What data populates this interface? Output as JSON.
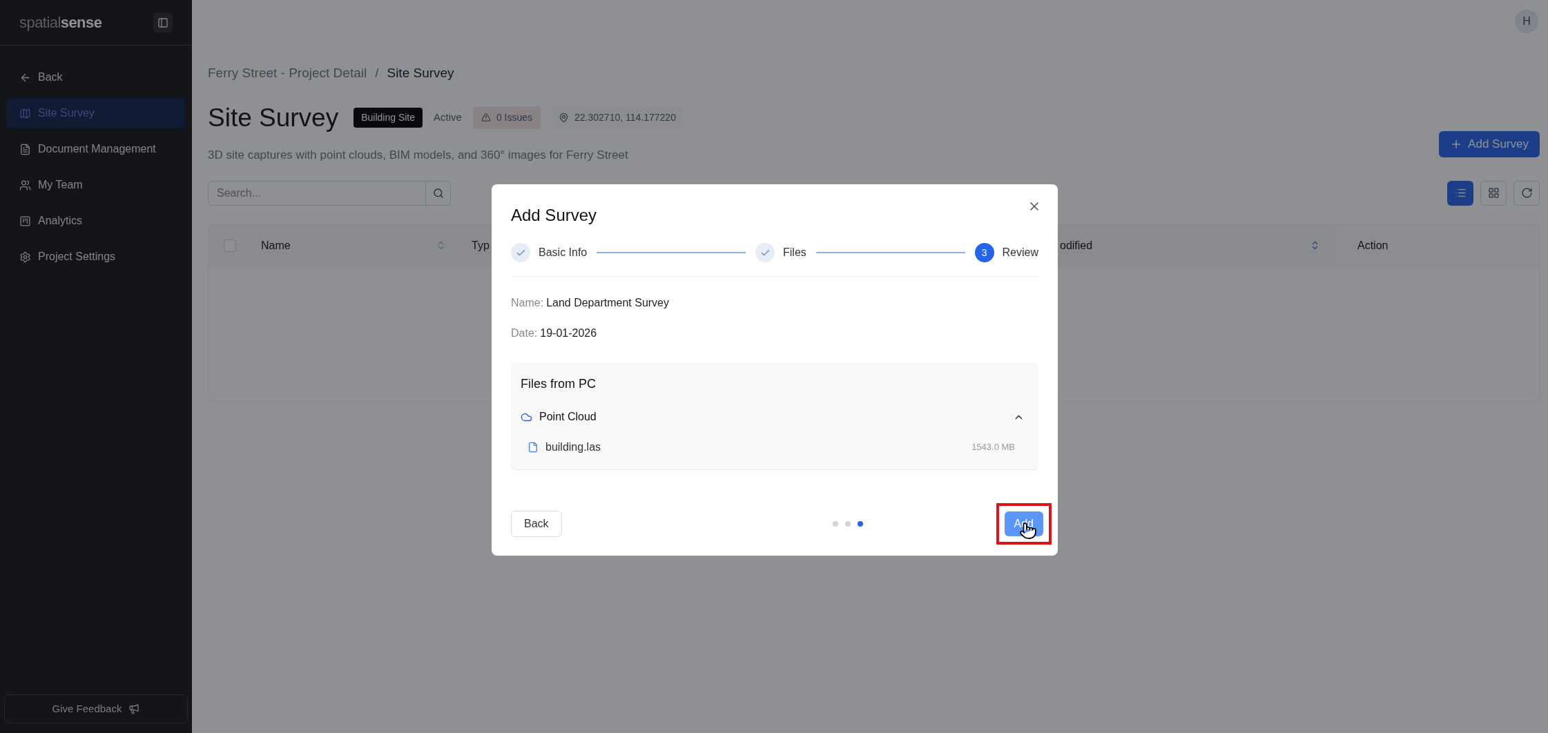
{
  "sidebar": {
    "logo": {
      "light": "spatial",
      "bold": "sense"
    },
    "items": [
      {
        "label": "Back",
        "kind": "back",
        "selected": false
      },
      {
        "label": "Site Survey",
        "kind": "map",
        "selected": true
      },
      {
        "label": "Document Management",
        "kind": "document",
        "selected": false
      },
      {
        "label": "My Team",
        "kind": "team",
        "selected": false
      },
      {
        "label": "Analytics",
        "kind": "board",
        "selected": false
      },
      {
        "label": "Project Settings",
        "kind": "settings",
        "selected": false
      }
    ],
    "feedback": "Give Feedback"
  },
  "avatar": "H",
  "breadcrumb": {
    "items": [
      "Ferry Street - Project Detail",
      "Site Survey"
    ],
    "separator": "/"
  },
  "title": "Site Survey",
  "tags": {
    "type": "Building Site",
    "status": "Active",
    "issues": "0 Issues",
    "coordinates": "22.302710, 114.177220"
  },
  "description": "3D site captures with point clouds, BIM models, and 360° images for Ferry Street",
  "search": {
    "placeholder": "Search..."
  },
  "add_button": "Add Survey",
  "view_buttons": [
    {
      "kind": "list",
      "selected": true
    },
    {
      "kind": "grid",
      "selected": false
    },
    {
      "kind": "refresh",
      "selected": false
    }
  ],
  "table": {
    "select_all": {
      "checked": false
    },
    "columns": [
      {
        "label": "Name",
        "kind": "sortable",
        "sorted": false
      },
      {
        "label": "Typ",
        "kind": "plain"
      },
      {
        "label": "odified",
        "kind": "sortable",
        "sorted": true
      },
      {
        "label": "Action",
        "kind": "plain"
      }
    ]
  },
  "modal": {
    "title": "Add Survey",
    "steps": [
      {
        "label": "Basic Info",
        "kind": "done"
      },
      {
        "label": "Files",
        "kind": "done"
      },
      {
        "label": "Review",
        "kind": "current",
        "number": "3"
      }
    ],
    "fields": [
      {
        "label": "Name:",
        "value": "Land Department Survey"
      },
      {
        "label": "Date:",
        "value": "19-01-2026"
      }
    ],
    "files_panel": {
      "title": "Files from PC",
      "groups": [
        {
          "name": "Point Cloud",
          "expanded": true,
          "files": [
            {
              "name": "building.las",
              "size": "1543.0 MB"
            }
          ]
        }
      ]
    },
    "back_button": "Back",
    "pager": [
      {
        "selected": false
      },
      {
        "selected": false
      },
      {
        "selected": true
      }
    ],
    "confirm_button": {
      "label": "Add",
      "highlighted": true
    },
    "cursor": {
      "kind": "hand"
    }
  }
}
